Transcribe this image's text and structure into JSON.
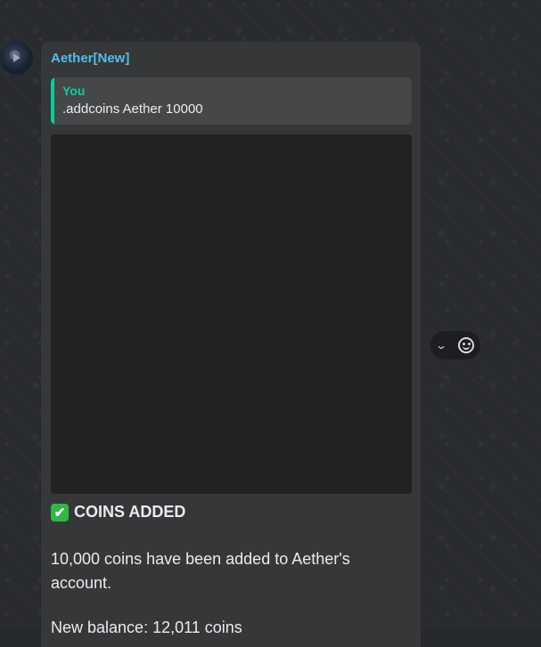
{
  "message": {
    "sender": "Aether[New]",
    "quote": {
      "author": "You",
      "text": ".addcoins Aether 10000"
    },
    "title": "COINS ADDED",
    "title_icon": "✔",
    "body": "10,000 coins have been added to Aether's account.",
    "balance": "New balance: 12,011 coins"
  },
  "actions": {
    "menu_icon": "⌄"
  },
  "colors": {
    "sender": "#53bdeb",
    "quote_accent": "#06cf9c",
    "bubble": "#363738",
    "check": "#2fb844"
  }
}
